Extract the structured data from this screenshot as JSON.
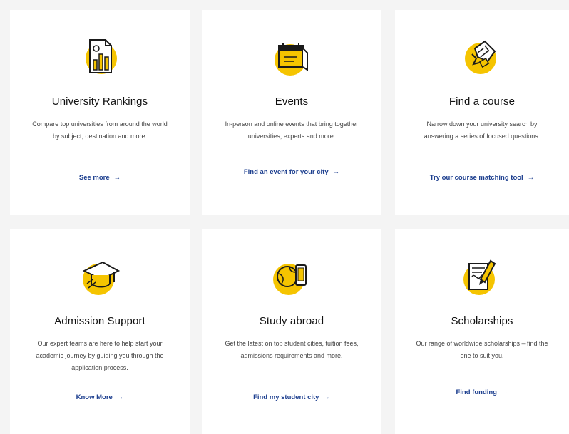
{
  "cards": [
    {
      "title": "University Rankings",
      "description": "Compare top universities from around the world by subject, destination and more.",
      "link": "See more",
      "arrow": "→",
      "icon": "rankings-document-icon"
    },
    {
      "title": "Events",
      "description": "In-person and online events that bring together universities, experts and more.",
      "link": "Find an event for your city",
      "arrow": "→",
      "icon": "calendar-icon"
    },
    {
      "title": "Find a course",
      "description": "Narrow down your university search by answering a series of focused questions.",
      "link": "Try our course matching tool",
      "arrow": "→",
      "icon": "puzzle-icon"
    },
    {
      "title": "Admission Support",
      "description": "Our expert teams are here to help start your academic journey by guiding you through the application process.",
      "link": "Know More",
      "arrow": "→",
      "icon": "graduation-cap-icon"
    },
    {
      "title": "Study abroad",
      "description": "Get the latest on top student cities, tuition fees, admissions requirements and more.",
      "link": "Find my student city",
      "arrow": "→",
      "icon": "globe-phone-icon"
    },
    {
      "title": "Scholarships",
      "description": "Our range of worldwide scholarships – find the one to suit you.",
      "link": "Find funding",
      "arrow": "→",
      "icon": "scholarship-pen-icon"
    }
  ],
  "colors": {
    "accent": "#f5c400",
    "link": "#1d3f8f",
    "background": "#f4f4f4"
  }
}
